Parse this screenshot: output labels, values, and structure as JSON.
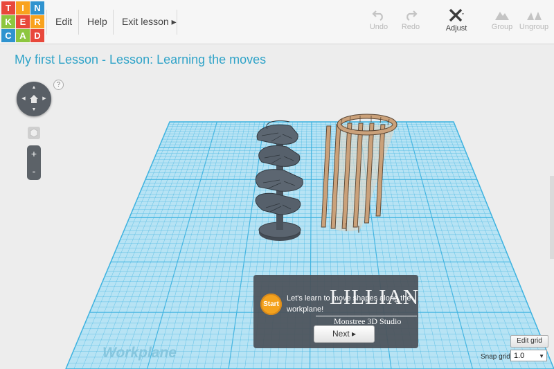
{
  "logo": {
    "letters": [
      "TIN",
      "KER",
      "CAD"
    ],
    "colors": [
      "#e8483b",
      "#f9a21d",
      "#2f93cf",
      "#8dc63f",
      "#e8483b",
      "#f9a21d",
      "#2f93cf",
      "#8dc63f",
      "#e8483b"
    ]
  },
  "menu": {
    "edit": "Edit",
    "help": "Help",
    "exit_lesson": "Exit lesson ▸"
  },
  "toolbar": {
    "undo": "Undo",
    "redo": "Redo",
    "adjust": "Adjust",
    "group": "Group",
    "ungroup": "Ungroup"
  },
  "lesson": {
    "title": "My first Lesson - Lesson: Learning the moves",
    "start_label": "Start",
    "text": "Let's learn to move shapes along the workplane!",
    "next_label": "Next ▸"
  },
  "watermark": {
    "name": "LILLIAN",
    "studio": "Monstree 3D Studio"
  },
  "nav": {
    "help_label": "?",
    "zoom_in": "+",
    "zoom_out": "-"
  },
  "workplane": {
    "label": "Workplane",
    "grid_color": "#3fb3e0",
    "fill_color": "#b7e3f4"
  },
  "grid_controls": {
    "edit_grid_label": "Edit grid",
    "snap_grid_label": "Snap grid",
    "snap_value": "1.0"
  },
  "colors": {
    "accent": "#2fa3c8",
    "start_button": "#f4a21d",
    "staircase": "#4f5964",
    "tower": "#caa17a"
  }
}
